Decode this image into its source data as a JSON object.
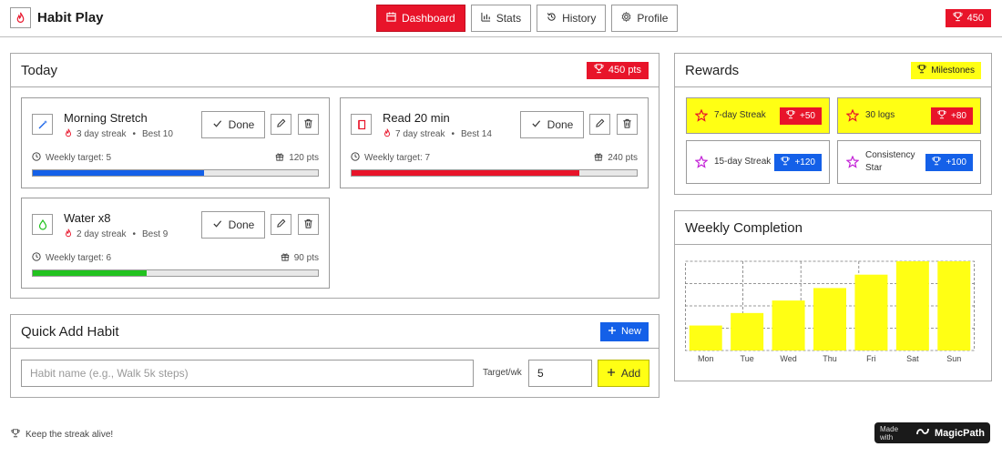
{
  "app": {
    "title": "Habit Play"
  },
  "nav": [
    {
      "label": "Dashboard",
      "icon": "calendar-icon",
      "active": true
    },
    {
      "label": "Stats",
      "icon": "bar-chart-icon",
      "active": false
    },
    {
      "label": "History",
      "icon": "history-icon",
      "active": false
    },
    {
      "label": "Profile",
      "icon": "gear-icon",
      "active": false
    }
  ],
  "header_points": "450",
  "today": {
    "title": "Today",
    "points": "450 pts",
    "habits": [
      {
        "name": "Morning Stretch",
        "icon": "wand-icon",
        "icon_color": "#1460e8",
        "streak": "3 day streak",
        "best": "Best 10",
        "target": "Weekly target: 5",
        "points": "120 pts",
        "progress": 0.6,
        "bar_color": "#1460e8",
        "done_label": "Done"
      },
      {
        "name": "Read 20 min",
        "icon": "book-icon",
        "icon_color": "#e8142a",
        "streak": "7 day streak",
        "best": "Best 14",
        "target": "Weekly target: 7",
        "points": "240 pts",
        "progress": 0.8,
        "bar_color": "#e8142a",
        "done_label": "Done"
      },
      {
        "name": "Water x8",
        "icon": "droplet-icon",
        "icon_color": "#22c21f",
        "streak": "2 day streak",
        "best": "Best 9",
        "target": "Weekly target: 6",
        "points": "90 pts",
        "progress": 0.4,
        "bar_color": "#22c21f",
        "done_label": "Done"
      }
    ]
  },
  "quick_add": {
    "title": "Quick Add Habit",
    "new_label": "New",
    "name_placeholder": "Habit name (e.g., Walk 5k steps)",
    "target_label": "Target/wk",
    "target_value": "5",
    "add_label": "Add"
  },
  "rewards": {
    "title": "Rewards",
    "milestones_label": "Milestones",
    "items": [
      {
        "label": "7-day Streak",
        "bonus": "+50",
        "style": "yellow"
      },
      {
        "label": "30 logs",
        "bonus": "+80",
        "style": "yellow"
      },
      {
        "label": "15-day Streak",
        "bonus": "+120",
        "style": "plain"
      },
      {
        "label": "Consistency Star",
        "bonus": "+100",
        "style": "plain"
      }
    ]
  },
  "weekly": {
    "title": "Weekly Completion"
  },
  "chart_data": {
    "type": "bar",
    "categories": [
      "Mon",
      "Tue",
      "Wed",
      "Thu",
      "Fri",
      "Sat",
      "Sun"
    ],
    "values": [
      28,
      42,
      56,
      70,
      85,
      100,
      100
    ],
    "ylim": [
      0,
      100
    ],
    "grid": true,
    "bar_color": "#ffff14"
  },
  "footer": {
    "tagline": "Keep the streak alive!"
  },
  "badge": {
    "small": "Made with",
    "big": "MagicPath"
  },
  "colors": {
    "accent_red": "#e8142a",
    "accent_blue": "#1460e8",
    "accent_yellow": "#ffff14",
    "accent_green": "#22c21f",
    "star_purple": "#c21fd6"
  }
}
